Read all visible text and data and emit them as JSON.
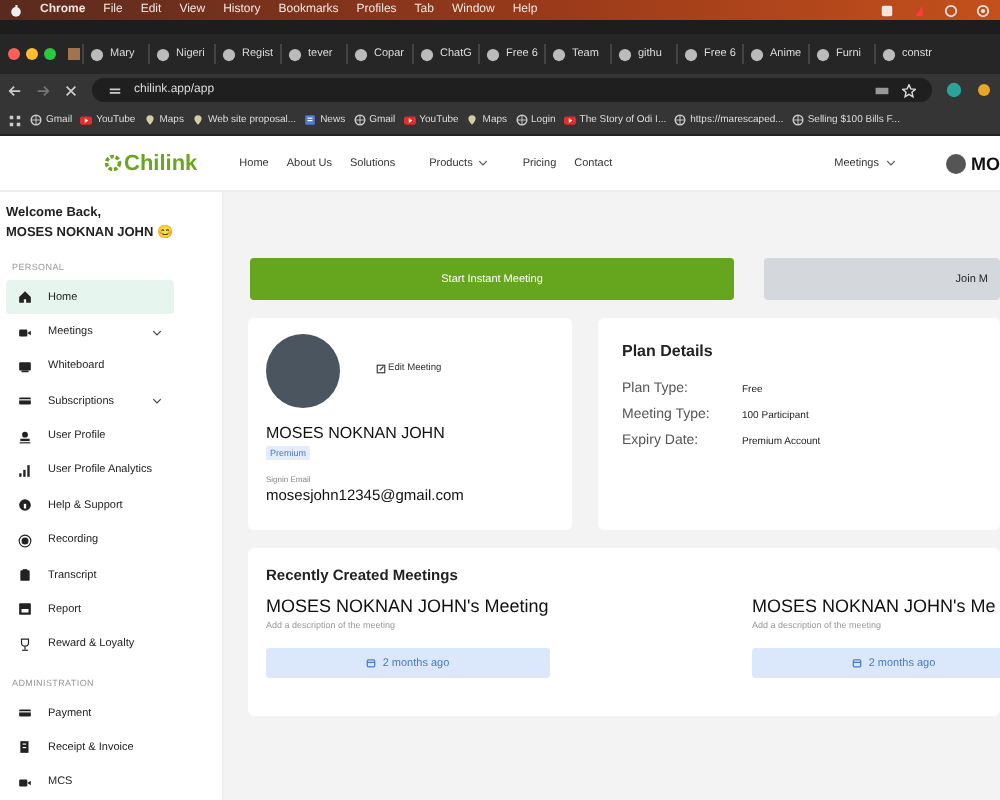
{
  "os_menu": {
    "app": "Chrome",
    "items": [
      "File",
      "Edit",
      "View",
      "History",
      "Bookmarks",
      "Profiles",
      "Tab",
      "Window",
      "Help"
    ]
  },
  "browser_tabs": [
    {
      "label": "Mary"
    },
    {
      "label": "Nigeri"
    },
    {
      "label": "Regist"
    },
    {
      "label": "tever"
    },
    {
      "label": "Copar"
    },
    {
      "label": "ChatG"
    },
    {
      "label": "Free 6"
    },
    {
      "label": "Team"
    },
    {
      "label": "githu"
    },
    {
      "label": "Free 6"
    },
    {
      "label": "Anime"
    },
    {
      "label": "Furni"
    },
    {
      "label": "constr"
    }
  ],
  "address_bar": {
    "url": "chilink.app/app"
  },
  "bookmarks": [
    {
      "label": "Gmail"
    },
    {
      "label": "YouTube"
    },
    {
      "label": "Maps"
    },
    {
      "label": "Web site proposal..."
    },
    {
      "label": "News"
    },
    {
      "label": "Gmail"
    },
    {
      "label": "YouTube"
    },
    {
      "label": "Maps"
    },
    {
      "label": "Login"
    },
    {
      "label": "The Story of Odi I..."
    },
    {
      "label": "https://marescaped..."
    },
    {
      "label": "Selling $100 Bills F..."
    }
  ],
  "site_nav": {
    "logo": "Chilink",
    "links": [
      {
        "label": "Home",
        "dropdown": false
      },
      {
        "label": "About Us",
        "dropdown": false
      },
      {
        "label": "Solutions",
        "dropdown": false
      },
      {
        "label": "Products",
        "dropdown": true
      },
      {
        "label": "Pricing",
        "dropdown": false
      },
      {
        "label": "Contact",
        "dropdown": false
      }
    ],
    "meetings_menu": "Meetings",
    "user": "MO"
  },
  "sidebar": {
    "greeting": "Welcome Back,",
    "user_name": "MOSES NOKNAN JOHN",
    "emoji": "😊",
    "sections": [
      {
        "heading": "PERSONAL",
        "items": [
          {
            "label": "Home",
            "selected": true,
            "expandable": false
          },
          {
            "label": "Meetings",
            "selected": false,
            "expandable": true
          },
          {
            "label": "Whiteboard",
            "selected": false,
            "expandable": false
          },
          {
            "label": "Subscriptions",
            "selected": false,
            "expandable": true
          },
          {
            "label": "User Profile",
            "selected": false,
            "expandable": false
          },
          {
            "label": "User Profile Analytics",
            "selected": false,
            "expandable": false
          },
          {
            "label": "Help & Support",
            "selected": false,
            "expandable": false
          },
          {
            "label": "Recording",
            "selected": false,
            "expandable": false
          },
          {
            "label": "Transcript",
            "selected": false,
            "expandable": false
          },
          {
            "label": "Report",
            "selected": false,
            "expandable": false
          },
          {
            "label": "Reward & Loyalty",
            "selected": false,
            "expandable": false
          }
        ]
      },
      {
        "heading": "ADMINISTRATION",
        "items": [
          {
            "label": "Payment",
            "selected": false,
            "expandable": false
          },
          {
            "label": "Receipt & Invoice",
            "selected": false,
            "expandable": false
          },
          {
            "label": "MCS",
            "selected": false,
            "expandable": false
          }
        ]
      }
    ]
  },
  "actions": [
    {
      "label": "Start Instant Meeting",
      "kind": "primary"
    },
    {
      "label": "Join M",
      "kind": "secondary"
    }
  ],
  "profile": {
    "name": "MOSES NOKNAN JOHN",
    "badge": "Premium",
    "edit": "Edit Meeting",
    "email_label": "Signin Email",
    "email": "mosesjohn12345@gmail.com"
  },
  "plan": {
    "title": "Plan Details",
    "rows": [
      {
        "label": "Plan Type:",
        "value": "Free"
      },
      {
        "label": "Meeting Type:",
        "value": "100 Participant"
      },
      {
        "label": "Expiry Date:",
        "value": "Premium Account"
      }
    ]
  },
  "recent": {
    "title": "Recently Created Meetings",
    "meetings": [
      {
        "title": "MOSES NOKNAN JOHN's Meeting",
        "description": "Add a description of the meeting",
        "time": "2 months ago"
      },
      {
        "title": "MOSES NOKNAN JOHN's Me",
        "description": "Add a description of the meeting",
        "time": "2 months ago"
      }
    ]
  }
}
